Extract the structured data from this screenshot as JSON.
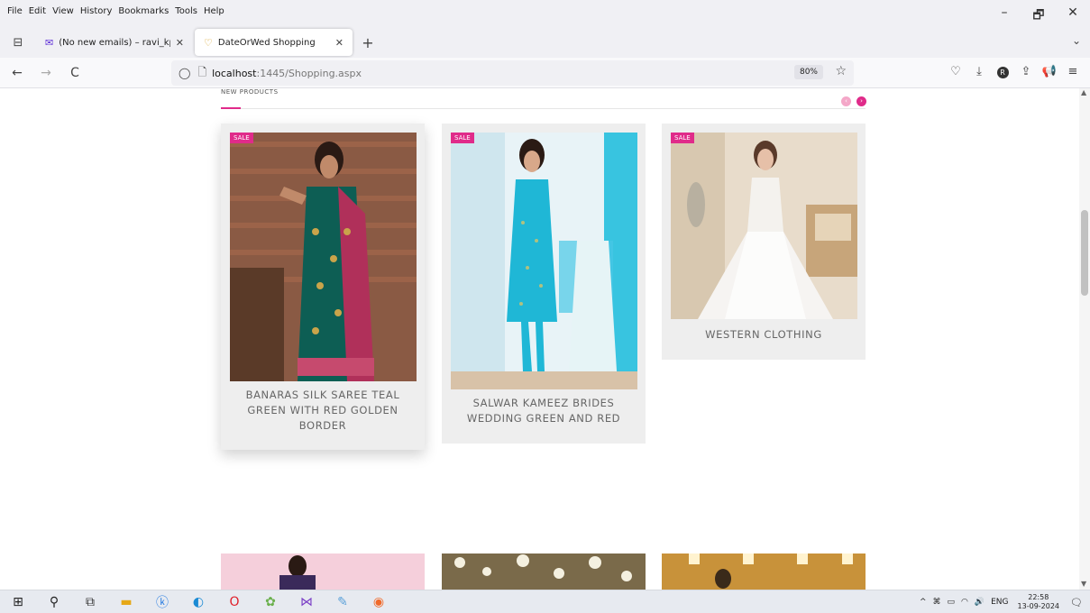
{
  "menu": [
    "File",
    "Edit",
    "View",
    "History",
    "Bookmarks",
    "Tools",
    "Help"
  ],
  "window_controls": {
    "minimize": "–",
    "restore": "🗗",
    "close": "✕"
  },
  "tabs": [
    {
      "label": "(No new emails) – ravi_kp_com",
      "icon": "✉",
      "close": "✕"
    },
    {
      "label": "DateOrWed Shopping",
      "icon": "♡",
      "close": "✕"
    }
  ],
  "new_tab": "+",
  "tab_overflow": "⌄",
  "nav": {
    "back": "←",
    "forward": "→",
    "reload": "C"
  },
  "url": {
    "host": "localhost",
    "path": ":1445/Shopping.aspx",
    "zoom": "80%",
    "star": "☆"
  },
  "toolbar_icons": {
    "pocket": "♡",
    "download": "⤓",
    "profile": "R",
    "share": "⇪",
    "megaphone": "📢",
    "menu": "≡"
  },
  "section": {
    "title": "NEW PRODUCTS",
    "prev": "‹",
    "next": "›"
  },
  "products": [
    {
      "name": "BANARAS SILK SAREE TEAL GREEN WITH RED GOLDEN BORDER",
      "badge": "SALE"
    },
    {
      "name": "SALWAR KAMEEZ BRIDES WEDDING GREEN AND RED",
      "badge": "SALE"
    },
    {
      "name": "WESTERN CLOTHING",
      "badge": "SALE"
    }
  ],
  "scrollbar": {
    "up": "▲",
    "down": "▼"
  },
  "taskbar": {
    "tray_text": "ENG",
    "time": "22:58",
    "date": "13-09-2024",
    "tray_chevron": "^",
    "notification": "🗨"
  },
  "colors": {
    "accent": "#e02b8a",
    "card_bg": "#eeeeee"
  }
}
